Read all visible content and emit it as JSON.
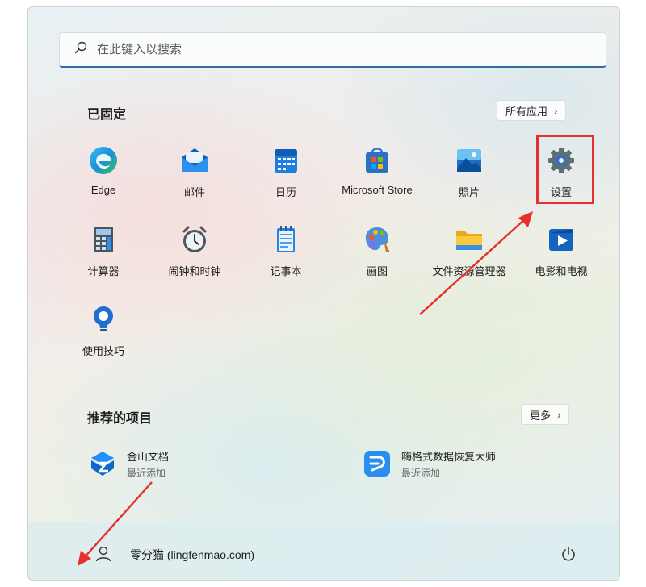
{
  "search": {
    "placeholder": "在此键入以搜索",
    "icon": "search-icon"
  },
  "pinned": {
    "title": "已固定",
    "all_apps_label": "所有应用",
    "apps": [
      {
        "label": "Edge",
        "icon": "edge-icon"
      },
      {
        "label": "邮件",
        "icon": "mail-icon"
      },
      {
        "label": "日历",
        "icon": "calendar-icon"
      },
      {
        "label": "Microsoft Store",
        "icon": "store-icon"
      },
      {
        "label": "照片",
        "icon": "photos-icon"
      },
      {
        "label": "设置",
        "icon": "settings-gear-icon"
      },
      {
        "label": "计算器",
        "icon": "calculator-icon"
      },
      {
        "label": "闹钟和时钟",
        "icon": "alarm-clock-icon"
      },
      {
        "label": "记事本",
        "icon": "notepad-icon"
      },
      {
        "label": "画图",
        "icon": "paint-icon"
      },
      {
        "label": "文件资源管理器",
        "icon": "folder-icon"
      },
      {
        "label": "电影和电视",
        "icon": "movies-tv-icon"
      },
      {
        "label": "使用技巧",
        "icon": "tips-icon"
      }
    ]
  },
  "recommended": {
    "title": "推荐的项目",
    "more_label": "更多",
    "items": [
      {
        "name": "金山文档",
        "subtitle": "最近添加",
        "icon": "kingsoft-docs-icon"
      },
      {
        "name": "嗨格式数据恢复大师",
        "subtitle": "最近添加",
        "icon": "data-recovery-icon"
      }
    ]
  },
  "footer": {
    "user_name": "零分猫 (lingfenmao.com)",
    "avatar_icon": "user-icon",
    "power_icon": "power-icon"
  },
  "colors": {
    "accent": "#2f6ca3",
    "annotation": "#e5312e"
  }
}
